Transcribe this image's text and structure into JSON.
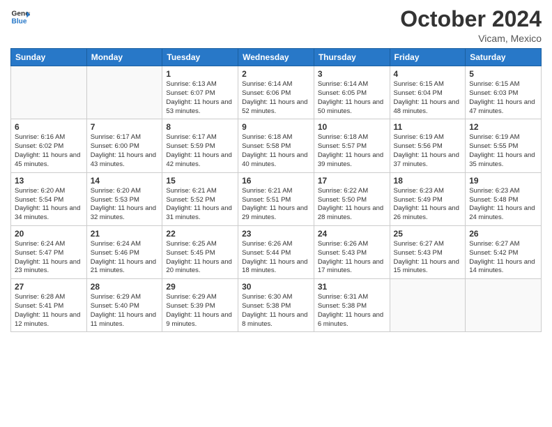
{
  "header": {
    "logo_general": "General",
    "logo_blue": "Blue",
    "month_title": "October 2024",
    "location": "Vicam, Mexico"
  },
  "weekdays": [
    "Sunday",
    "Monday",
    "Tuesday",
    "Wednesday",
    "Thursday",
    "Friday",
    "Saturday"
  ],
  "weeks": [
    [
      {
        "day": "",
        "info": ""
      },
      {
        "day": "",
        "info": ""
      },
      {
        "day": "1",
        "info": "Sunrise: 6:13 AM\nSunset: 6:07 PM\nDaylight: 11 hours and 53 minutes."
      },
      {
        "day": "2",
        "info": "Sunrise: 6:14 AM\nSunset: 6:06 PM\nDaylight: 11 hours and 52 minutes."
      },
      {
        "day": "3",
        "info": "Sunrise: 6:14 AM\nSunset: 6:05 PM\nDaylight: 11 hours and 50 minutes."
      },
      {
        "day": "4",
        "info": "Sunrise: 6:15 AM\nSunset: 6:04 PM\nDaylight: 11 hours and 48 minutes."
      },
      {
        "day": "5",
        "info": "Sunrise: 6:15 AM\nSunset: 6:03 PM\nDaylight: 11 hours and 47 minutes."
      }
    ],
    [
      {
        "day": "6",
        "info": "Sunrise: 6:16 AM\nSunset: 6:02 PM\nDaylight: 11 hours and 45 minutes."
      },
      {
        "day": "7",
        "info": "Sunrise: 6:17 AM\nSunset: 6:00 PM\nDaylight: 11 hours and 43 minutes."
      },
      {
        "day": "8",
        "info": "Sunrise: 6:17 AM\nSunset: 5:59 PM\nDaylight: 11 hours and 42 minutes."
      },
      {
        "day": "9",
        "info": "Sunrise: 6:18 AM\nSunset: 5:58 PM\nDaylight: 11 hours and 40 minutes."
      },
      {
        "day": "10",
        "info": "Sunrise: 6:18 AM\nSunset: 5:57 PM\nDaylight: 11 hours and 39 minutes."
      },
      {
        "day": "11",
        "info": "Sunrise: 6:19 AM\nSunset: 5:56 PM\nDaylight: 11 hours and 37 minutes."
      },
      {
        "day": "12",
        "info": "Sunrise: 6:19 AM\nSunset: 5:55 PM\nDaylight: 11 hours and 35 minutes."
      }
    ],
    [
      {
        "day": "13",
        "info": "Sunrise: 6:20 AM\nSunset: 5:54 PM\nDaylight: 11 hours and 34 minutes."
      },
      {
        "day": "14",
        "info": "Sunrise: 6:20 AM\nSunset: 5:53 PM\nDaylight: 11 hours and 32 minutes."
      },
      {
        "day": "15",
        "info": "Sunrise: 6:21 AM\nSunset: 5:52 PM\nDaylight: 11 hours and 31 minutes."
      },
      {
        "day": "16",
        "info": "Sunrise: 6:21 AM\nSunset: 5:51 PM\nDaylight: 11 hours and 29 minutes."
      },
      {
        "day": "17",
        "info": "Sunrise: 6:22 AM\nSunset: 5:50 PM\nDaylight: 11 hours and 28 minutes."
      },
      {
        "day": "18",
        "info": "Sunrise: 6:23 AM\nSunset: 5:49 PM\nDaylight: 11 hours and 26 minutes."
      },
      {
        "day": "19",
        "info": "Sunrise: 6:23 AM\nSunset: 5:48 PM\nDaylight: 11 hours and 24 minutes."
      }
    ],
    [
      {
        "day": "20",
        "info": "Sunrise: 6:24 AM\nSunset: 5:47 PM\nDaylight: 11 hours and 23 minutes."
      },
      {
        "day": "21",
        "info": "Sunrise: 6:24 AM\nSunset: 5:46 PM\nDaylight: 11 hours and 21 minutes."
      },
      {
        "day": "22",
        "info": "Sunrise: 6:25 AM\nSunset: 5:45 PM\nDaylight: 11 hours and 20 minutes."
      },
      {
        "day": "23",
        "info": "Sunrise: 6:26 AM\nSunset: 5:44 PM\nDaylight: 11 hours and 18 minutes."
      },
      {
        "day": "24",
        "info": "Sunrise: 6:26 AM\nSunset: 5:43 PM\nDaylight: 11 hours and 17 minutes."
      },
      {
        "day": "25",
        "info": "Sunrise: 6:27 AM\nSunset: 5:43 PM\nDaylight: 11 hours and 15 minutes."
      },
      {
        "day": "26",
        "info": "Sunrise: 6:27 AM\nSunset: 5:42 PM\nDaylight: 11 hours and 14 minutes."
      }
    ],
    [
      {
        "day": "27",
        "info": "Sunrise: 6:28 AM\nSunset: 5:41 PM\nDaylight: 11 hours and 12 minutes."
      },
      {
        "day": "28",
        "info": "Sunrise: 6:29 AM\nSunset: 5:40 PM\nDaylight: 11 hours and 11 minutes."
      },
      {
        "day": "29",
        "info": "Sunrise: 6:29 AM\nSunset: 5:39 PM\nDaylight: 11 hours and 9 minutes."
      },
      {
        "day": "30",
        "info": "Sunrise: 6:30 AM\nSunset: 5:38 PM\nDaylight: 11 hours and 8 minutes."
      },
      {
        "day": "31",
        "info": "Sunrise: 6:31 AM\nSunset: 5:38 PM\nDaylight: 11 hours and 6 minutes."
      },
      {
        "day": "",
        "info": ""
      },
      {
        "day": "",
        "info": ""
      }
    ]
  ]
}
